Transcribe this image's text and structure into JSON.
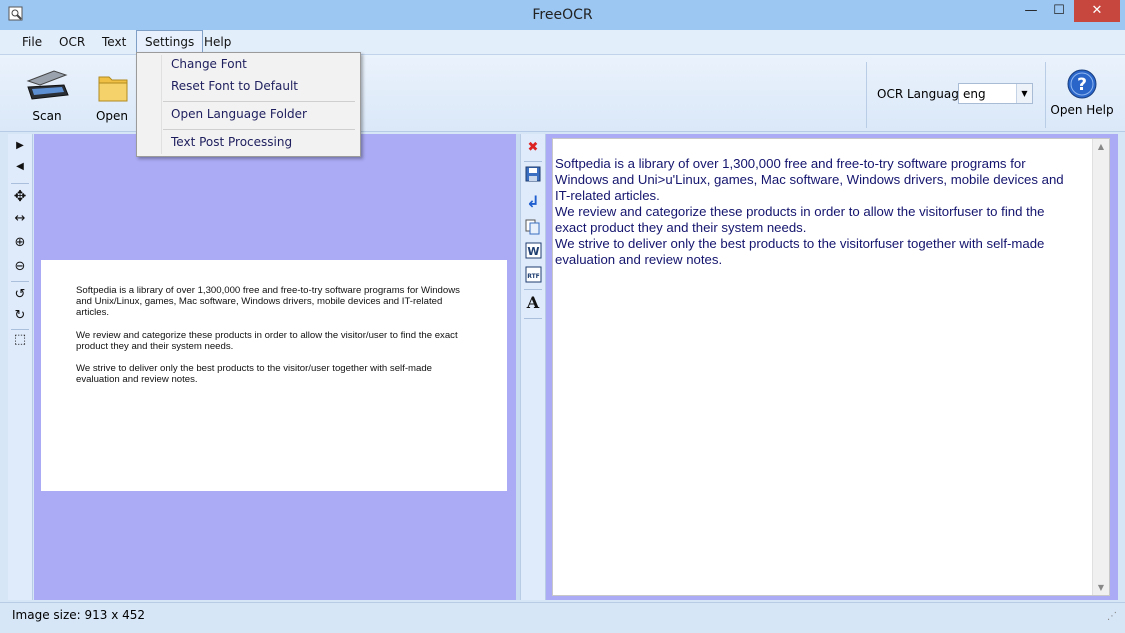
{
  "window": {
    "title": "FreeOCR",
    "minimize": "—",
    "maximize": "☐",
    "close": "✕"
  },
  "menu": {
    "file": "File",
    "ocr": "OCR",
    "text": "Text",
    "settings": "Settings",
    "help": "Help"
  },
  "settings_menu": {
    "items": [
      "Change Font",
      "Reset Font to Default",
      "Open Language Folder",
      "Text Post Processing"
    ]
  },
  "toolbar": {
    "scan_label": "Scan",
    "open_label": "Open",
    "ocr_language_label": "OCR Language:",
    "ocr_language_value": "eng",
    "open_help_label": "Open Help"
  },
  "left_tools": {
    "next": "▶",
    "prev": "◀",
    "move": "✥",
    "fit_width": "↔",
    "zoom_in": "⊕",
    "zoom_out": "⊖",
    "rotate_left": "↺",
    "rotate_right": "↻",
    "select": "⬚"
  },
  "right_tools": {
    "clear": "✖",
    "save": "💾",
    "return": "↲",
    "copy": "⧉",
    "word": "W",
    "rtf": "RTF",
    "font": "A"
  },
  "image": {
    "paragraphs": [
      "Softpedia is a library of over 1,300,000 free and free-to-try software programs for Windows and Unix/Linux,  games, Mac software, Windows drivers, mobile devices and IT-related articles.",
      "We review and categorize these products in order to allow the visitor/user to find the exact product they and their system needs.",
      "We strive to deliver only the best products to the visitor/user together with self-made evaluation and review notes."
    ]
  },
  "ocr_text": "Softpedia is a library of over 1,300,000 free and free-to-try software programs for\nWindows and Uni>u'Linux, games, Mac software, Windows drivers, mobile devices and\nIT-related articles.\nWe review and categorize these products in order to allow the visitorfuser to find the\nexact product they and their system needs.\nWe strive to deliver only the best products to the visitorfuser together with self-made\nevaluation and review notes.",
  "status": {
    "image_size": "Image size:  913 x  452"
  },
  "colors": {
    "pane_bg": "#aaaaf5",
    "text_color": "#14146e",
    "help_blue": "#2a66c9"
  }
}
